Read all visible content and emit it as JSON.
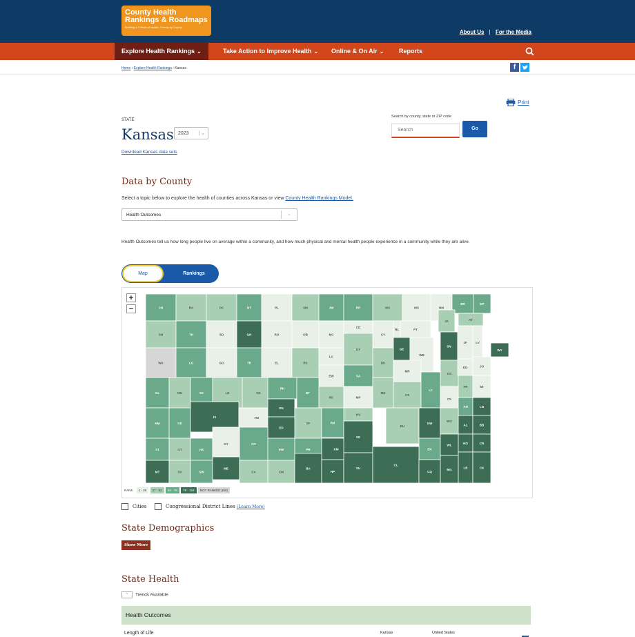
{
  "header": {
    "logo": {
      "line1": "County Health",
      "line2": "Rankings & Roadmaps",
      "tagline": "Building a Culture of Health, County by County"
    },
    "links": {
      "about": "About Us",
      "separator": "|",
      "media": "For the Media"
    },
    "nav": [
      "Explore Health Rankings",
      "Take Action to Improve Health",
      "Online & On Air",
      "Reports"
    ],
    "nav_dropdown_glyph": "⌄",
    "search_icon": "search-icon"
  },
  "breadcrumb": {
    "home": "Home",
    "sep": "›",
    "explore": "Explore Health Rankings",
    "current": "Kansas"
  },
  "social": {
    "facebook": "f",
    "twitter": "t"
  },
  "print": {
    "label": "Print",
    "icon": "printer-icon"
  },
  "state": {
    "eyebrow": "STATE",
    "name": "Kansas",
    "year": "2023",
    "download_link": "Download Kansas data sets"
  },
  "search": {
    "label": "Search by county, state or ZIP code",
    "placeholder": "Search",
    "button": "Go"
  },
  "data_by_county": {
    "heading": "Data by County",
    "intro_text": "Select a topic below to explore the health of counties across Kansas or view ",
    "intro_link": "County Health Rankings Model.",
    "topic_selected": "Health Outcomes",
    "description": "Health Outcomes tell us how long people live on average within a community, and how much physical and mental health people experience in a community while they are alive."
  },
  "view_toggle": {
    "map": "Map",
    "rankings": "Rankings",
    "selected": "Map"
  },
  "map": {
    "zoom_in": "+",
    "zoom_out": "−",
    "legend": {
      "label": "RANK",
      "bins": [
        {
          "label": "1 - 26",
          "color": "#e8f0e8"
        },
        {
          "label": "27 - 52",
          "color": "#a8ceb4"
        },
        {
          "label": "53 - 78",
          "color": "#6aa98a"
        },
        {
          "label": "79 - 104",
          "color": "#3d6e55"
        },
        {
          "label": "NOT RANKED (NR)",
          "color": "#d6d6d6"
        }
      ]
    },
    "counties": [
      [
        "CN",
        "CN",
        2
      ],
      [
        "RA",
        "RA",
        1
      ],
      [
        "DC",
        "DC",
        1
      ],
      [
        "NT",
        "NT",
        2
      ],
      [
        "PL",
        "PL",
        0
      ],
      [
        "SM",
        "SM",
        1
      ],
      [
        "JW",
        "JW",
        2
      ],
      [
        "RP",
        "RP",
        2
      ],
      [
        "WS",
        "WS",
        1
      ],
      [
        "MS",
        "MS",
        0
      ],
      [
        "NM",
        "NM",
        0
      ],
      [
        "BR",
        "BR",
        2
      ],
      [
        "DP",
        "DP",
        2
      ],
      [
        "SH",
        "SH",
        1
      ],
      [
        "TH",
        "TH",
        2
      ],
      [
        "SD",
        "SD",
        0
      ],
      [
        "GH",
        "GH",
        3
      ],
      [
        "RO",
        "RO",
        0
      ],
      [
        "OB",
        "OB",
        0
      ],
      [
        "MC",
        "MC",
        0
      ],
      [
        "CD",
        "CD",
        0
      ],
      [
        "CY",
        "CY",
        0
      ],
      [
        "RL",
        "RL",
        0
      ],
      [
        "PT",
        "PT",
        0
      ],
      [
        "JA",
        "JA",
        1
      ],
      [
        "AT",
        "AT",
        1
      ],
      [
        "WA",
        "WA",
        4
      ],
      [
        "LG",
        "LG",
        2
      ],
      [
        "GO",
        "GO",
        0
      ],
      [
        "TR",
        "TR",
        2
      ],
      [
        "EL",
        "EL",
        0
      ],
      [
        "RS",
        "RS",
        1
      ],
      [
        "LC",
        "LC",
        0
      ],
      [
        "OT",
        "OT",
        1
      ],
      [
        "DK",
        "DK",
        1
      ],
      [
        "GE",
        "GE",
        3
      ],
      [
        "WB",
        "WB",
        0
      ],
      [
        "SN",
        "SN",
        3
      ],
      [
        "JF",
        "JF",
        0
      ],
      [
        "LV",
        "LV",
        0
      ],
      [
        "WY",
        "WY",
        3
      ],
      [
        "EW",
        "EW",
        0
      ],
      [
        "SA",
        "SA",
        2
      ],
      [
        "MR",
        "MR",
        0
      ],
      [
        "OS",
        "OS",
        1
      ],
      [
        "DG",
        "DG",
        0
      ],
      [
        "JO",
        "JO",
        0
      ],
      [
        "GL",
        "GL",
        2
      ],
      [
        "WH",
        "WH",
        1
      ],
      [
        "SC",
        "SC",
        2
      ],
      [
        "LE",
        "LE",
        1
      ],
      [
        "NS",
        "NS",
        1
      ],
      [
        "RH",
        "RH",
        2
      ],
      [
        "BT",
        "BT",
        2
      ],
      [
        "RC",
        "RC",
        1
      ],
      [
        "MP",
        "MP",
        0
      ],
      [
        "MN",
        "MN",
        1
      ],
      [
        "CS",
        "CS",
        1
      ],
      [
        "LY",
        "LY",
        2
      ],
      [
        "FR",
        "FR",
        1
      ],
      [
        "MI",
        "MI",
        0
      ],
      [
        "CF",
        "CF",
        0
      ],
      [
        "AN",
        "AN",
        2
      ],
      [
        "LN",
        "LN",
        3
      ],
      [
        "HM",
        "HM",
        2
      ],
      [
        "KE",
        "KE",
        2
      ],
      [
        "FI",
        "FI",
        3
      ],
      [
        "HG",
        "HG",
        0
      ],
      [
        "PN",
        "PN",
        3
      ],
      [
        "SF",
        "SF",
        1
      ],
      [
        "HV",
        "HV",
        1
      ],
      [
        "BU",
        "BU",
        1
      ],
      [
        "GW",
        "GW",
        3
      ],
      [
        "WO",
        "WO",
        1
      ],
      [
        "AL",
        "AL",
        3
      ],
      [
        "BB",
        "BB",
        3
      ],
      [
        "ED",
        "ED",
        3
      ],
      [
        "RN",
        "RN",
        2
      ],
      [
        "ST",
        "ST",
        2
      ],
      [
        "GT",
        "GT",
        1
      ],
      [
        "HS",
        "HS",
        2
      ],
      [
        "GY",
        "GY",
        0
      ],
      [
        "FO",
        "FO",
        2
      ],
      [
        "KW",
        "KW",
        2
      ],
      [
        "PR",
        "PR",
        2
      ],
      [
        "KM",
        "KM",
        3
      ],
      [
        "SG",
        "SG",
        3
      ],
      [
        "EK",
        "EK",
        2
      ],
      [
        "WL",
        "WL",
        3
      ],
      [
        "NO",
        "NO",
        3
      ],
      [
        "CR",
        "CR",
        3
      ],
      [
        "MT",
        "MT",
        3
      ],
      [
        "SV",
        "SV",
        1
      ],
      [
        "SW",
        "SW",
        2
      ],
      [
        "ME",
        "ME",
        3
      ],
      [
        "CA",
        "CA",
        1
      ],
      [
        "CM",
        "CM",
        1
      ],
      [
        "BA",
        "BA",
        3
      ],
      [
        "HP",
        "HP",
        3
      ],
      [
        "SU",
        "SU",
        3
      ],
      [
        "CL",
        "CL",
        3
      ],
      [
        "CQ",
        "CQ",
        3
      ],
      [
        "MG",
        "MG",
        3
      ],
      [
        "LB",
        "LB",
        3
      ],
      [
        "CK",
        "CK",
        3
      ]
    ]
  },
  "checkboxes": {
    "cities": "Cities",
    "districts": "Congressional District Lines",
    "learn_more": "(Learn More)"
  },
  "demographics": {
    "heading": "State Demographics",
    "button": "Show More"
  },
  "state_health": {
    "heading": "State Health",
    "trends": "Trends Available",
    "category": "Health Outcomes",
    "row_label": "Length of Life",
    "col_state": "Kansas",
    "col_us": "United States"
  }
}
